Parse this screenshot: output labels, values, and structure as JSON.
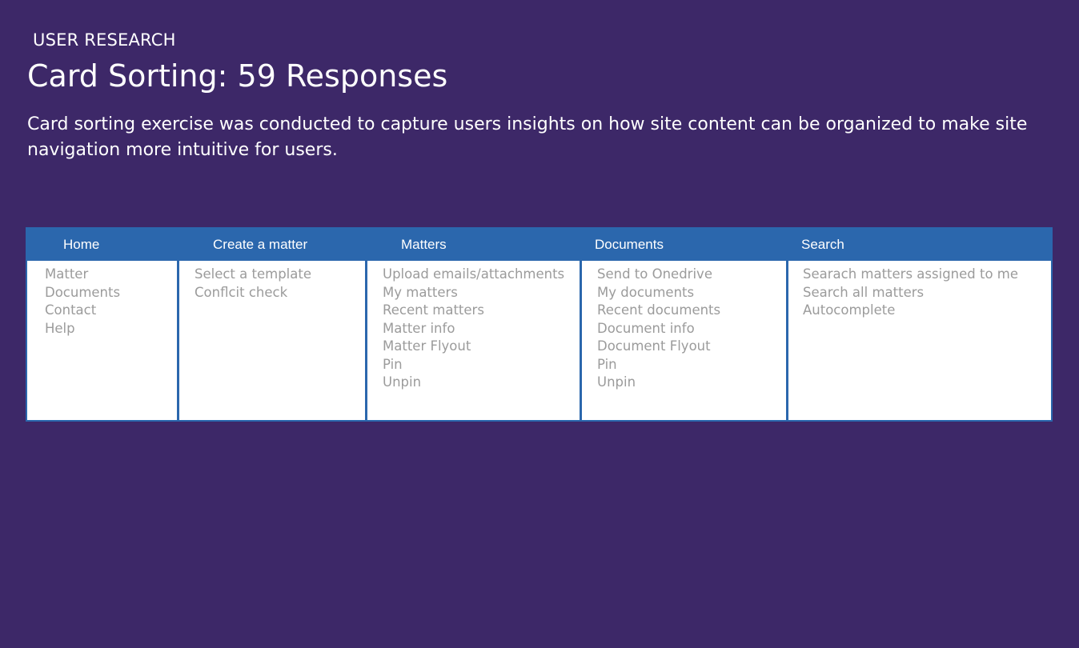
{
  "header": {
    "eyebrow": "USER RESEARCH",
    "title": "Card Sorting: 59 Responses",
    "description": "Card sorting exercise was conducted to capture users insights on how site content can be organized to make site navigation more intuitive for users."
  },
  "colors": {
    "background": "#3d2868",
    "header_blue": "#2b67ad",
    "item_text": "#9b9b9b"
  },
  "columns": [
    {
      "title": "Home",
      "items": [
        "Matter",
        "Documents",
        "Contact",
        "Help"
      ]
    },
    {
      "title": "Create a matter",
      "items": [
        "Select a template",
        "Conflcit check"
      ]
    },
    {
      "title": "Matters",
      "items": [
        "Upload emails/attachments",
        "My matters",
        "Recent matters",
        "Matter info",
        "Matter Flyout",
        "Pin",
        "Unpin"
      ]
    },
    {
      "title": "Documents",
      "items": [
        "Send to Onedrive",
        "My documents",
        "Recent documents",
        "Document info",
        "Document Flyout",
        "Pin",
        "Unpin"
      ]
    },
    {
      "title": "Search",
      "items": [
        "Searach matters assigned to me",
        "Search all matters",
        "Autocomplete"
      ]
    }
  ]
}
